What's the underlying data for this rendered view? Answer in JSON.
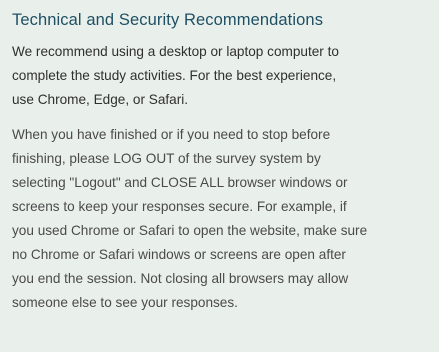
{
  "panel": {
    "title": "Technical and Security Recommendations",
    "paragraph_1": "We recommend using a desktop or laptop computer to\ncomplete the study activities. For the best experience,\nuse Chrome, Edge, or Safari.",
    "paragraph_2": "When you have finished or if you need to stop before\nfinishing, please LOG OUT of the survey system by\nselecting \"Logout\" and CLOSE ALL browser windows or\nscreens to keep your responses secure. For example, if\nyou used Chrome or Safari to open the website, make sure\nno Chrome or Safari windows or screens are open after\nyou end the session. Not closing all browsers may allow\nsomeone else to see your responses.",
    "colors": {
      "background": "#e9f0ec",
      "title": "#1f4f63",
      "text": "#2f2f2f"
    }
  }
}
